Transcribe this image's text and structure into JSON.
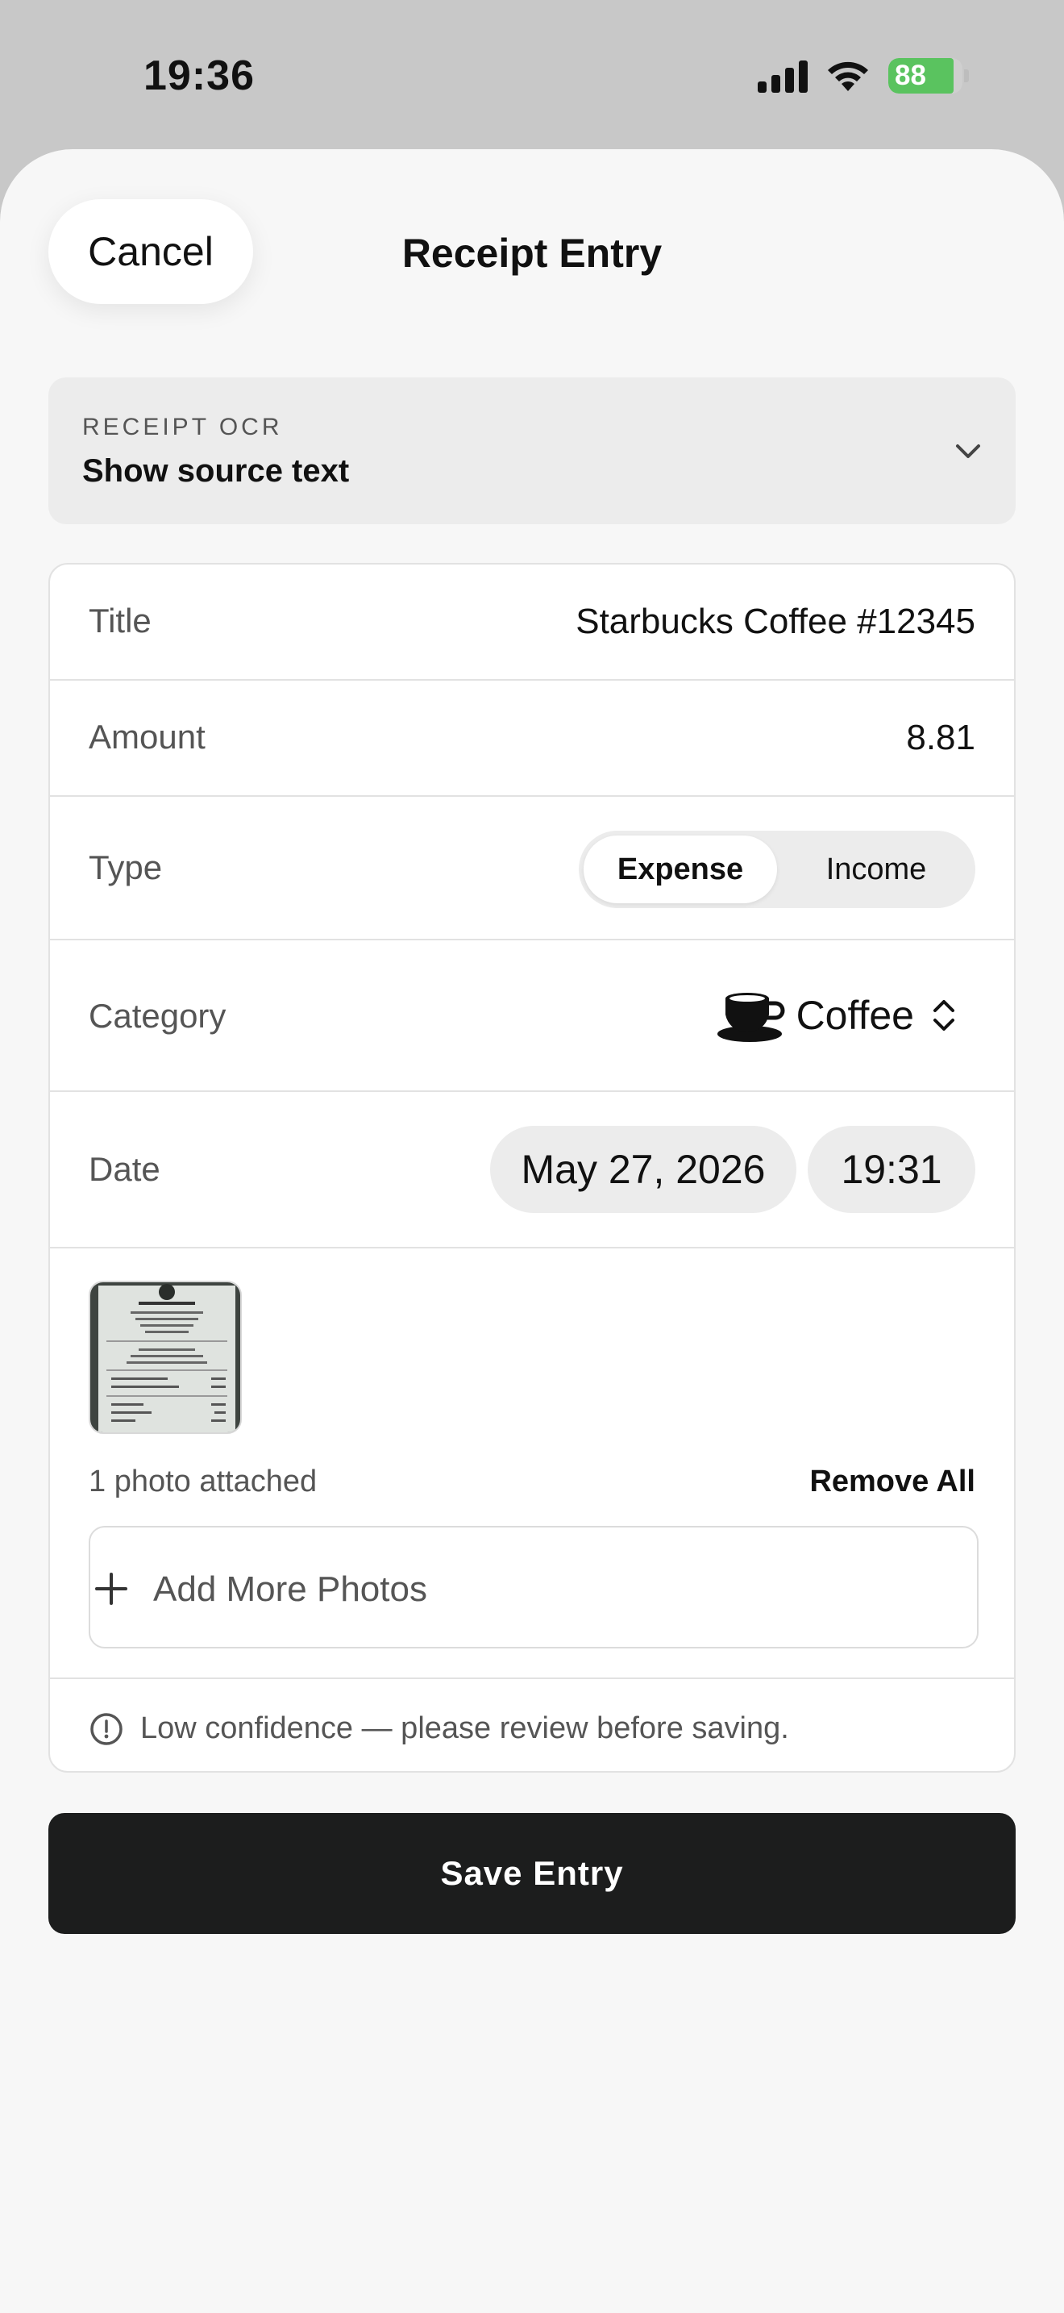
{
  "status_bar": {
    "time": "19:36",
    "battery": "88",
    "battery_level": 0.88,
    "battery_color": "#5ac35f",
    "icons": [
      "signal-icon",
      "wifi-icon",
      "battery-icon"
    ]
  },
  "header": {
    "cancel_label": "Cancel",
    "title": "Receipt Entry"
  },
  "ocr": {
    "label": "RECEIPT OCR",
    "toggle_label": "Show source text",
    "icon": "chevron-down-icon"
  },
  "form": {
    "title": {
      "label": "Title",
      "value": "Starbucks Coffee #12345"
    },
    "amount": {
      "label": "Amount",
      "value": "8.81"
    },
    "type": {
      "label": "Type",
      "options": [
        "Expense",
        "Income"
      ],
      "selected": "Expense"
    },
    "category": {
      "label": "Category",
      "value": "Coffee",
      "icon": "coffee-cup-icon"
    },
    "date": {
      "label": "Date",
      "date": "May 27, 2026",
      "time": "19:31"
    },
    "photos": {
      "count_text": "1 photo attached",
      "remove_all_label": "Remove All",
      "add_more_label": "Add More Photos"
    },
    "warning": {
      "text": "Low confidence — please review before saving.",
      "icon": "exclamation-circle-icon"
    }
  },
  "save_label": "Save Entry",
  "colors": {
    "accent_dark": "#1c1d1d",
    "sheet_bg": "#f7f7f7",
    "status_bg": "#c8c8c8",
    "battery_green": "#5ac35f"
  }
}
